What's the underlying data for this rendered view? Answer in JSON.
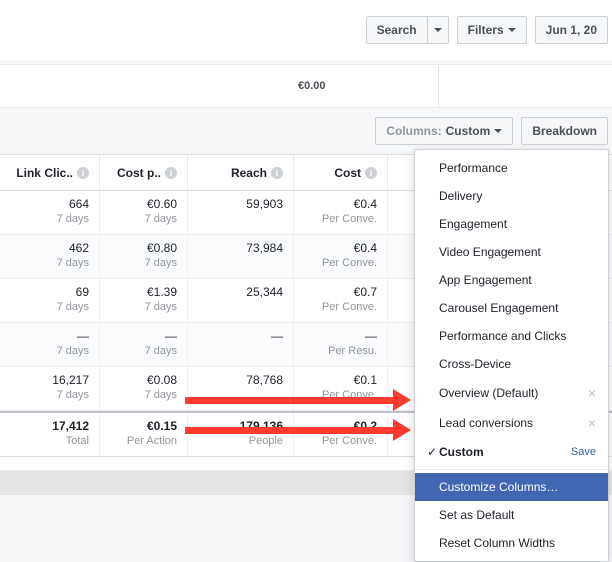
{
  "topbar": {
    "search": "Search",
    "filters": "Filters",
    "date": "Jun 1, 20"
  },
  "midbar": {
    "zero": "€0.00"
  },
  "toolbar": {
    "columns_label": "Columns:",
    "columns_value": "Custom",
    "breakdown": "Breakdown"
  },
  "columns": [
    "Link Clic..",
    "Cost p..",
    "Reach",
    "Cost"
  ],
  "rows": [
    {
      "c0": "664",
      "c0s": "7 days",
      "c1": "€0.60",
      "c1s": "7 days",
      "c2": "59,903",
      "c2s": "",
      "c3": "€0.4",
      "c3s": "Per Conve."
    },
    {
      "c0": "462",
      "c0s": "7 days",
      "c1": "€0.80",
      "c1s": "7 days",
      "c2": "73,984",
      "c2s": "",
      "c3": "€0.4",
      "c3s": "Per Conve."
    },
    {
      "c0": "69",
      "c0s": "7 days",
      "c1": "€1.39",
      "c1s": "7 days",
      "c2": "25,344",
      "c2s": "",
      "c3": "€0.7",
      "c3s": "Per Conve."
    },
    {
      "c0": "—",
      "c0s": "7 days",
      "c1": "—",
      "c1s": "7 days",
      "c2": "—",
      "c2s": "",
      "c3": "—",
      "c3s": "Per Resu."
    },
    {
      "c0": "16,217",
      "c0s": "7 days",
      "c1": "€0.08",
      "c1s": "7 days",
      "c2": "78,768",
      "c2s": "",
      "c3": "€0.1",
      "c3s": "Per Conve."
    }
  ],
  "footer": {
    "c0": "17,412",
    "c0s": "Total",
    "c1": "€0.15",
    "c1s": "Per Action",
    "c2": "179,136",
    "c2s": "People",
    "c3": "€0.2",
    "c3s": "Per Conve."
  },
  "menu": {
    "items": [
      "Performance",
      "Delivery",
      "Engagement",
      "Video Engagement",
      "App Engagement",
      "Carousel Engagement",
      "Performance and Clicks",
      "Cross-Device",
      "Overview (Default)",
      "Lead conversions"
    ],
    "custom": "Custom",
    "save": "Save",
    "customize": "Customize Columns…",
    "set_default": "Set as Default",
    "reset": "Reset Column Widths"
  }
}
